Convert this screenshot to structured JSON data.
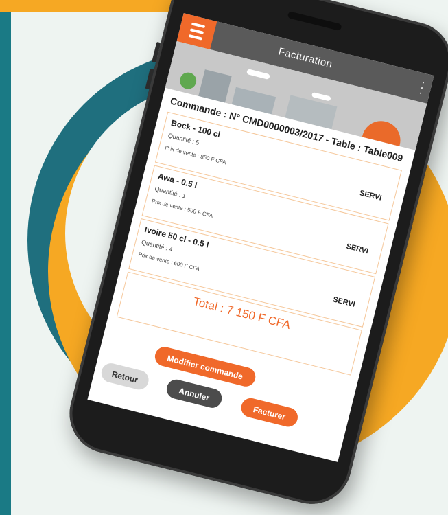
{
  "app": {
    "title": "Facturation"
  },
  "order": {
    "title": "Commande : N° CMD0000003/2017 - Table : Table009",
    "items": [
      {
        "name": "Bock - 100 cl",
        "qty": "Quantité : 5",
        "price": "Prix de vente : 850 F CFA",
        "status": "SERVI"
      },
      {
        "name": "Awa - 0.5 l",
        "qty": "Quantité : 1",
        "price": "Prix de vente : 500 F CFA",
        "status": "SERVI"
      },
      {
        "name": "Ivoire 50 cl - 0.5 l",
        "qty": "Quantité : 4",
        "price": "Prix de vente : 600 F CFA",
        "status": "SERVI"
      }
    ],
    "total": "Total : 7 150 F CFA"
  },
  "buttons": {
    "modify": "Modifier commande",
    "back": "Retour",
    "cancel": "Annuler",
    "invoice": "Facturer"
  },
  "colors": {
    "accent": "#f0692a",
    "teal": "#1f6f7e",
    "orange": "#f6a823"
  }
}
